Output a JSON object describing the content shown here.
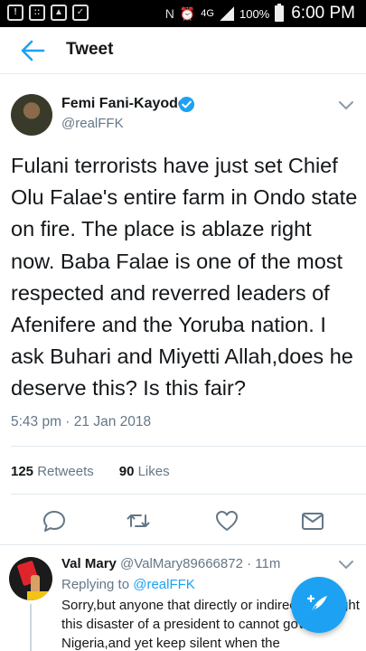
{
  "status_bar": {
    "network": "4G",
    "battery": "100%",
    "time": "6:00 PM"
  },
  "appbar": {
    "title": "Tweet"
  },
  "tweet": {
    "author_name": "Femi Fani-Kayode",
    "author_handle": "@realFFK",
    "text": "Fulani terrorists have just set Chief Olu Falae's entire farm in Ondo state on fire. The place is ablaze right now. Baba Falae is one of the most respected and reverred leaders of Afenifere and the Yoruba nation. I ask Buhari and Miyetti Allah,does he deserve this? Is this fair?",
    "timestamp": "5:43 pm · 21 Jan 2018",
    "retweets_count": "125",
    "retweets_label": "Retweets",
    "likes_count": "90",
    "likes_label": "Likes"
  },
  "reply": {
    "author_name": "Val Mary",
    "author_handle": "@ValMary89666872",
    "age": "· 11m",
    "replying_prefix": "Replying to",
    "replying_to": "@realFFK",
    "text": "Sorry,but anyone that directly or indirectly brought this disaster of a president to cannot govern Nigeria,and yet keep silent when the"
  },
  "colors": {
    "accent": "#1da1f2",
    "secondary_text": "#657786"
  },
  "icons": [
    "back-arrow-icon",
    "verified-badge-icon",
    "chevron-down-icon",
    "reply-icon",
    "retweet-icon",
    "like-icon",
    "share-icon",
    "compose-icon"
  ]
}
